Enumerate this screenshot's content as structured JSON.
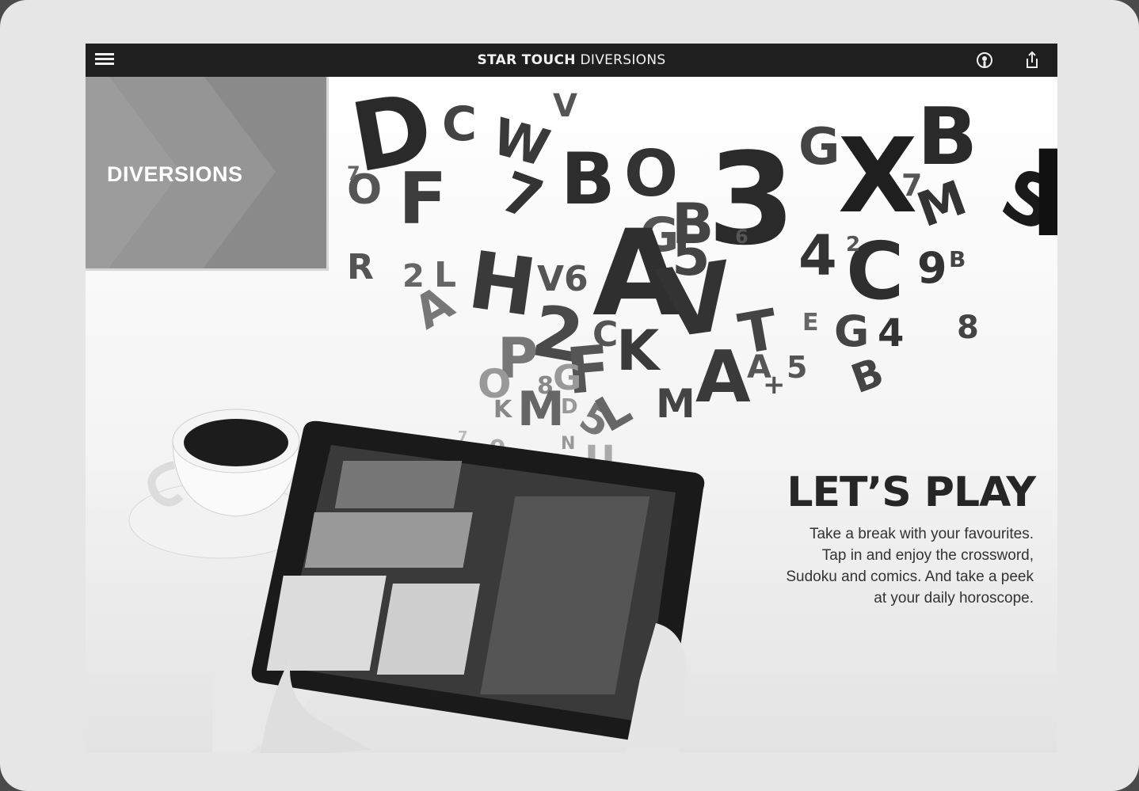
{
  "header": {
    "title_bold": "STAR TOUCH",
    "title_light": "DIVERSIONS",
    "menu_icon": "hamburger-menu-icon",
    "podcast_icon": "podcast-icon",
    "share_icon": "share-icon"
  },
  "section": {
    "label": "DIVERSIONS"
  },
  "promo": {
    "headline": "LET’S PLAY",
    "line1": "Take a break with your favourites.",
    "line2": "Tap in and enjoy the crossword,",
    "line3": "Sudoku and comics. And take a peek",
    "line4": "at your daily horoscope."
  },
  "colors": {
    "topbar": "#1f1f1f",
    "tile": "#8a8a8a",
    "text": "#262626"
  }
}
